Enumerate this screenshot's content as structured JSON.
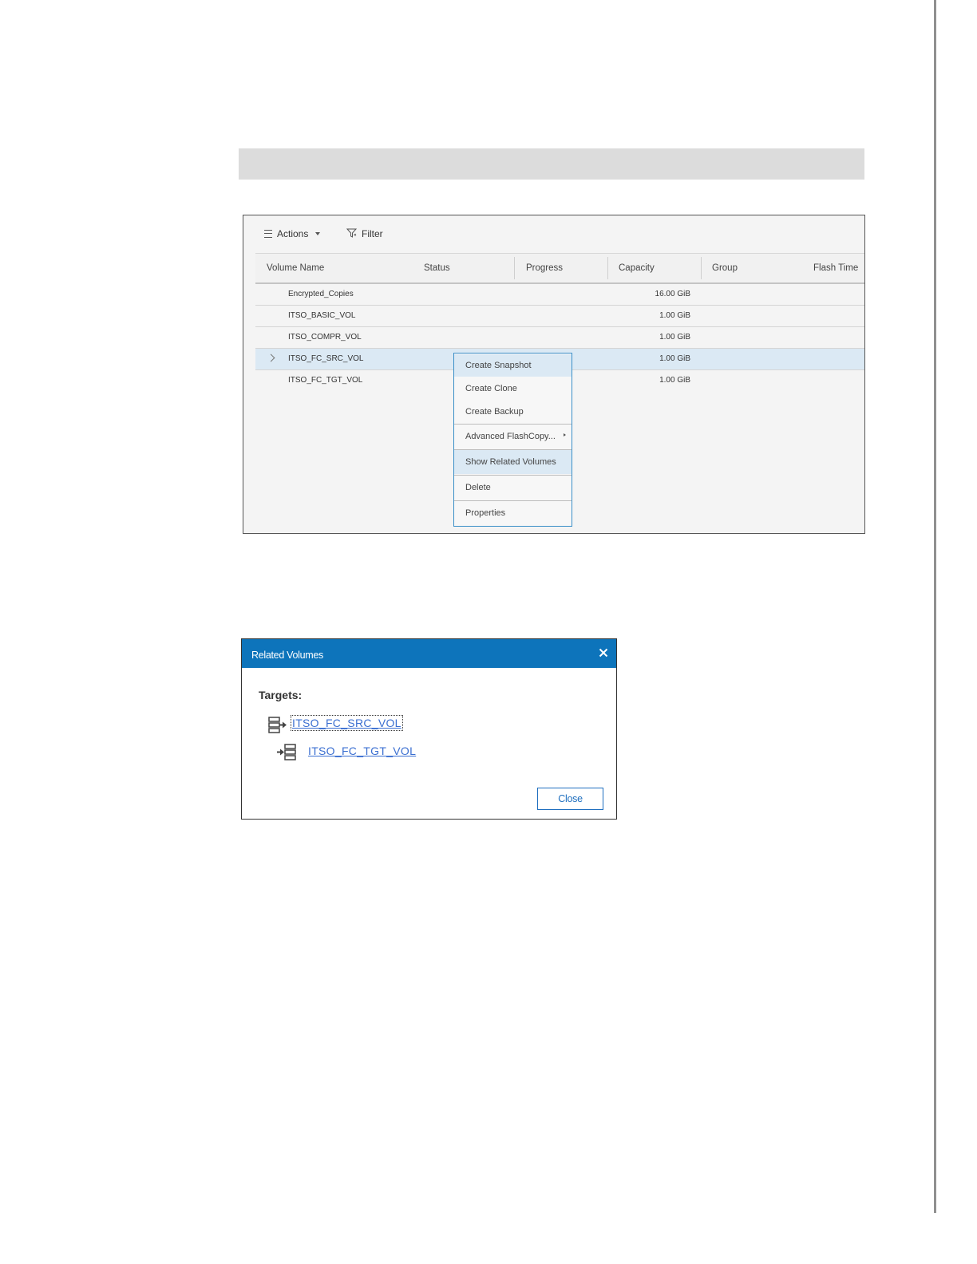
{
  "toolbar": {
    "actions_label": "Actions",
    "filter_label": "Filter"
  },
  "table": {
    "columns": [
      "Volume Name",
      "Status",
      "Progress",
      "Capacity",
      "Group",
      "Flash Time"
    ],
    "rows": [
      {
        "name": "Encrypted_Copies",
        "capacity": "16.00 GiB"
      },
      {
        "name": "ITSO_BASIC_VOL",
        "capacity": "1.00 GiB"
      },
      {
        "name": "ITSO_COMPR_VOL",
        "capacity": "1.00 GiB"
      },
      {
        "name": "ITSO_FC_SRC_VOL",
        "capacity": "1.00 GiB",
        "selected": true
      },
      {
        "name": "ITSO_FC_TGT_VOL",
        "capacity": "1.00 GiB"
      }
    ]
  },
  "context_menu": {
    "items": [
      "Create Snapshot",
      "Create Clone",
      "Create Backup",
      "Advanced FlashCopy...",
      "Show Related Volumes",
      "Delete",
      "Properties"
    ]
  },
  "dialog": {
    "title": "Related Volumes",
    "targets_label": "Targets:",
    "source_volume": "ITSO_FC_SRC_VOL",
    "target_volume": "ITSO_FC_TGT_VOL",
    "close_label": "Close",
    "header_color": "#0d74bb",
    "link_color": "#3b6fd1"
  },
  "icons": [
    "list-icon",
    "caret-down-icon",
    "filter-icon",
    "chevron-right-icon",
    "submenu-arrow-icon",
    "close-icon",
    "source-volume-icon",
    "target-volume-icon"
  ]
}
